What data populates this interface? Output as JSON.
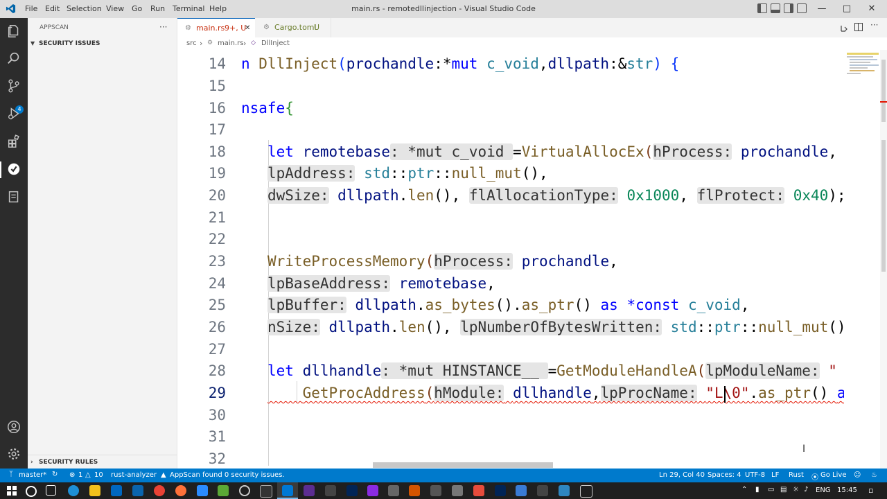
{
  "window": {
    "title": "main.rs - remotedllinjection - Visual Studio Code",
    "menu": [
      "File",
      "Edit",
      "Selection",
      "View",
      "Go",
      "Run",
      "Terminal",
      "Help"
    ]
  },
  "sidebar": {
    "header": "APPSCAN",
    "more": "···",
    "section_top": "SECURITY ISSUES",
    "section_bottom": "SECURITY RULES",
    "scm_badge": "4"
  },
  "tabs": [
    {
      "label": "main.rs",
      "status": "9+, U",
      "close": "✕"
    },
    {
      "label": "Cargo.toml",
      "status": "U"
    }
  ],
  "breadcrumb": [
    "src",
    "main.rs",
    "DllInject"
  ],
  "editor": {
    "line_numbers": [
      "14",
      "15",
      "16",
      "17",
      "18",
      "19",
      "20",
      "21",
      "22",
      "23",
      "24",
      "25",
      "26",
      "27",
      "28",
      "29",
      "30",
      "31",
      "32"
    ],
    "active_line": "29"
  },
  "status": {
    "branch": "master*",
    "errors": "1",
    "warnings": "10",
    "analyzer": "rust-analyzer",
    "appscan": "AppScan found 0 security issues.",
    "cursor": "Ln 29, Col 40",
    "spaces": "Spaces: 4",
    "encoding": "UTF-8",
    "eol": "LF",
    "language": "Rust",
    "golive": "Go Live"
  },
  "taskbar": {
    "lang": "ENG",
    "time": "15:45"
  },
  "colors": {
    "status_bar": "#007acc",
    "activity_bar": "#2c2c2c",
    "keyword": "#0000ff",
    "function": "#795e26",
    "type": "#267f99"
  }
}
